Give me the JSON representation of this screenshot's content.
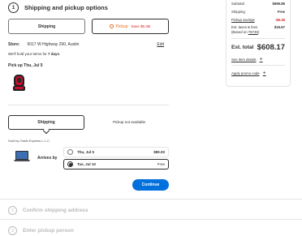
{
  "header": {
    "step_number": "1",
    "title": "Shipping and pickup options"
  },
  "fulfillment": {
    "shipping_label": "Shipping",
    "pickup_label": "Pickup",
    "pickup_savings": "Save $5.36!",
    "pickup_color": "#e26e1c",
    "savings_color": "#de1c24"
  },
  "store": {
    "label": "Store:",
    "address": "5017 W Highway 290, Austin",
    "edit": "Edit",
    "hold_prefix": "We'll hold your items for ",
    "hold_days": "7 days",
    "hold_suffix": ".",
    "pickup_date": "Pick up Thu, Jul 5"
  },
  "shipping": {
    "tab_label": "Shipping",
    "pickup_unavailable": "Pickup not available",
    "sold_by": "Sold by Oasis Express L.L.C.",
    "arrives_by": "Arrives by",
    "options": [
      {
        "date": "Thu, Jul 5",
        "price": "$80.00",
        "selected": false
      },
      {
        "date": "Tue, Jul 10",
        "price": "Free",
        "selected": true
      }
    ],
    "continue_label": "Continue",
    "continue_color": "#0071dc"
  },
  "future_steps": [
    {
      "number": "2",
      "title": "Confirm shipping address"
    },
    {
      "number": "3",
      "title": "Enter pickup person"
    }
  ],
  "summary": {
    "subtotal_label": "Subtotal",
    "subtotal": "$596.86",
    "shipping_label": "Shipping",
    "shipping": "Free",
    "pickup_savings_label": "Pickup savings",
    "pickup_savings": "-$5.36",
    "taxes_label": "Est. taxes & fees",
    "taxes": "$16.67",
    "based_on_prefix": "(Based on ",
    "zip": "78749",
    "based_on_suffix": ")",
    "est_total_label": "Est. total",
    "est_total": "$608.17",
    "see_details": "See item details",
    "promo": "Apply promo code"
  }
}
